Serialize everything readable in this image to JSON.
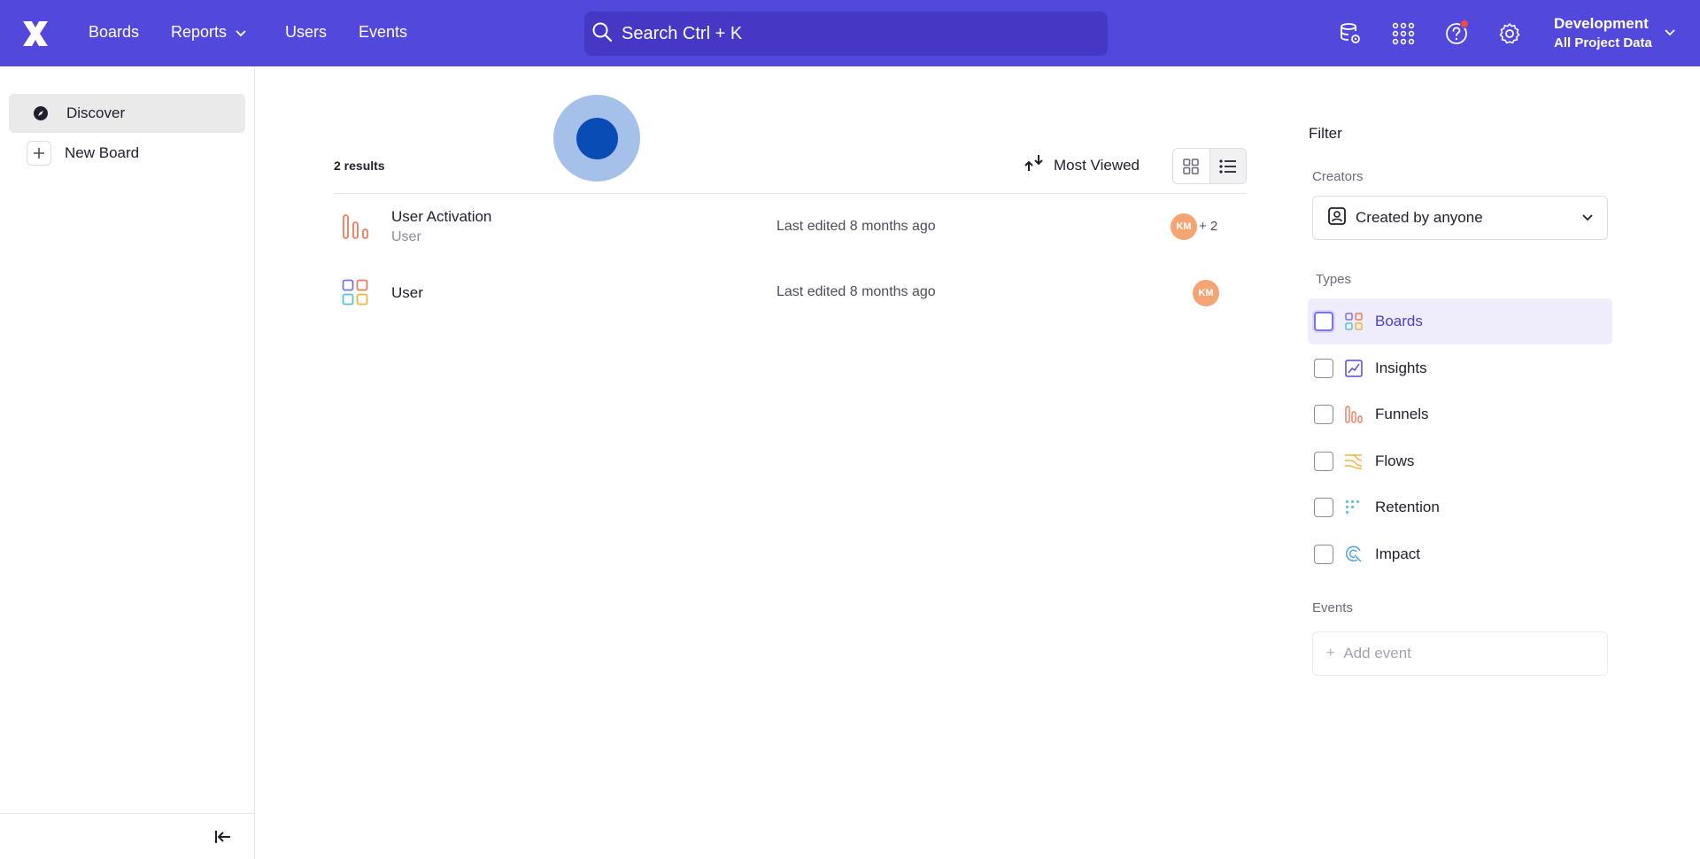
{
  "nav": {
    "logo_icon": "mixpanel-logo",
    "boards": "Boards",
    "reports": "Reports",
    "users": "Users",
    "events": "Events",
    "search_placeholder": "Search  Ctrl + K",
    "project_name": "Development",
    "project_scope": "All Project Data"
  },
  "sidebar": {
    "items": [
      {
        "label": "Discover",
        "icon": "compass-icon"
      },
      {
        "label": "New Board",
        "icon": "plus-icon"
      }
    ]
  },
  "main": {
    "results_count": "2 results",
    "sort_label": "Most Viewed",
    "rows": [
      {
        "title": "User Activation",
        "subtitle": "User",
        "edited": "Last edited 8 months ago",
        "avatar": "KM",
        "extra": "+ 2",
        "icon": "funnels-icon"
      },
      {
        "title": "User",
        "subtitle": "",
        "edited": "Last edited 8 months ago",
        "avatar": "KM",
        "icon": "board-icon"
      }
    ]
  },
  "filter": {
    "title": "Filter",
    "creators_label": "Creators",
    "creators_value": "Created by anyone",
    "types_label": "Types",
    "types": [
      {
        "label": "Boards",
        "checked": false
      },
      {
        "label": "Insights",
        "checked": false
      },
      {
        "label": "Funnels",
        "checked": false
      },
      {
        "label": "Flows",
        "checked": false
      },
      {
        "label": "Retention",
        "checked": false
      },
      {
        "label": "Impact",
        "checked": false
      }
    ],
    "events_label": "Events",
    "add_event": "Add event"
  },
  "colors": {
    "topbar": "#5348dc",
    "accent": "#4a40c8",
    "avatar": "#f5a574"
  }
}
